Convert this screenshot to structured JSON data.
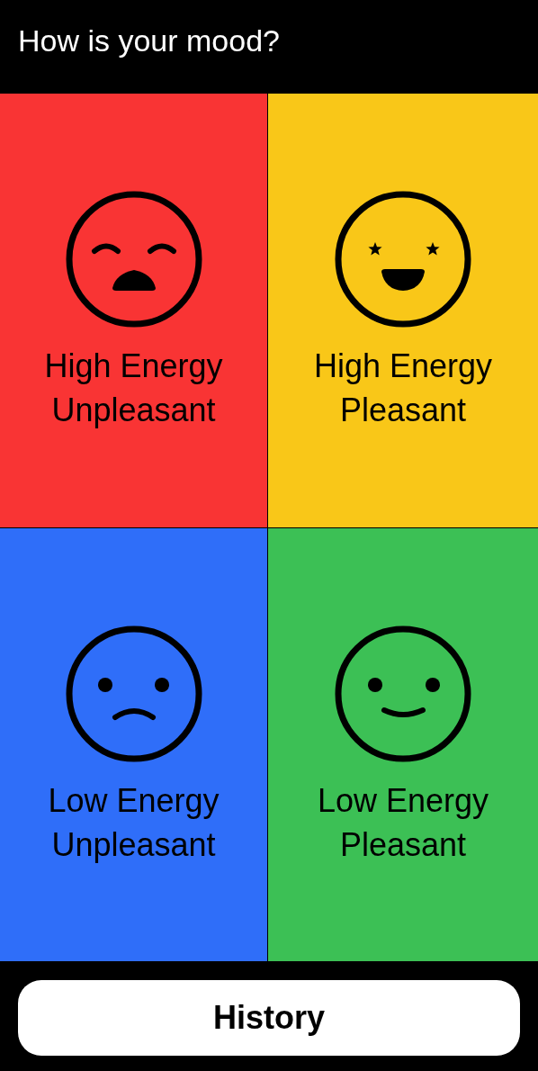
{
  "header": {
    "title": "How is your mood?"
  },
  "moods": [
    {
      "kind": "distressed",
      "color": "#f93434",
      "label_lines": [
        "High Energy",
        "Unpleasant"
      ]
    },
    {
      "kind": "excited",
      "color": "#f9c718",
      "label_lines": [
        "High Energy",
        "Pleasant"
      ]
    },
    {
      "kind": "sad",
      "color": "#2f6ef9",
      "label_lines": [
        "Low Energy",
        "Unpleasant"
      ]
    },
    {
      "kind": "content",
      "color": "#3cc055",
      "label_lines": [
        "Low Energy",
        "Pleasant"
      ]
    }
  ],
  "history_button": {
    "label": "History"
  }
}
